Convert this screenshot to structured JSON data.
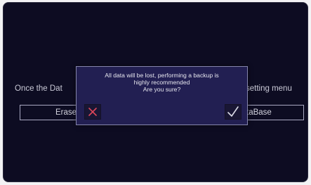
{
  "background": {
    "left_text": "Once the Dat",
    "right_text": "setting menu",
    "left_button_label": "Erase",
    "right_button_label": "taBase"
  },
  "dialog": {
    "message_lines": [
      "All data will be lost, performing a backup is",
      "highly recommended",
      "Are you sure?"
    ],
    "cancel_icon": "close-icon",
    "confirm_icon": "check-icon",
    "cancel_color": "#e0475a",
    "confirm_color": "#dcdce8"
  },
  "colors": {
    "screen_bg": "#0d0c22",
    "dialog_bg": "#221f52",
    "dialog_border": "#8585ac"
  }
}
